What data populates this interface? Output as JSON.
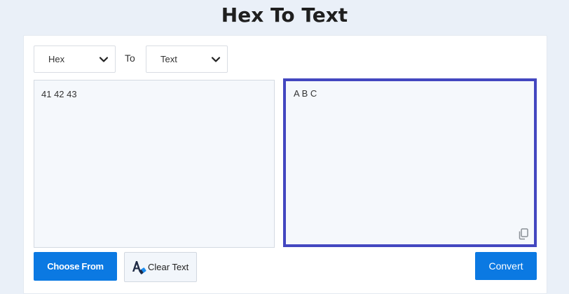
{
  "page": {
    "title": "Hex To Text"
  },
  "converter": {
    "from_select": {
      "value": "Hex",
      "icon": "chevron-down-icon"
    },
    "to_label": "To",
    "to_select": {
      "value": "Text",
      "icon": "chevron-down-icon"
    },
    "input": {
      "value": "41 42 43"
    },
    "output": {
      "value": "A B C",
      "copy_icon": "copy-icon"
    }
  },
  "actions": {
    "choose_from_label": "Choose From",
    "clear_text_label": "Clear Text",
    "convert_label": "Convert"
  },
  "colors": {
    "accent": "#0b79e2",
    "output_border": "#4347c0",
    "page_bg": "#eaf0f8"
  }
}
